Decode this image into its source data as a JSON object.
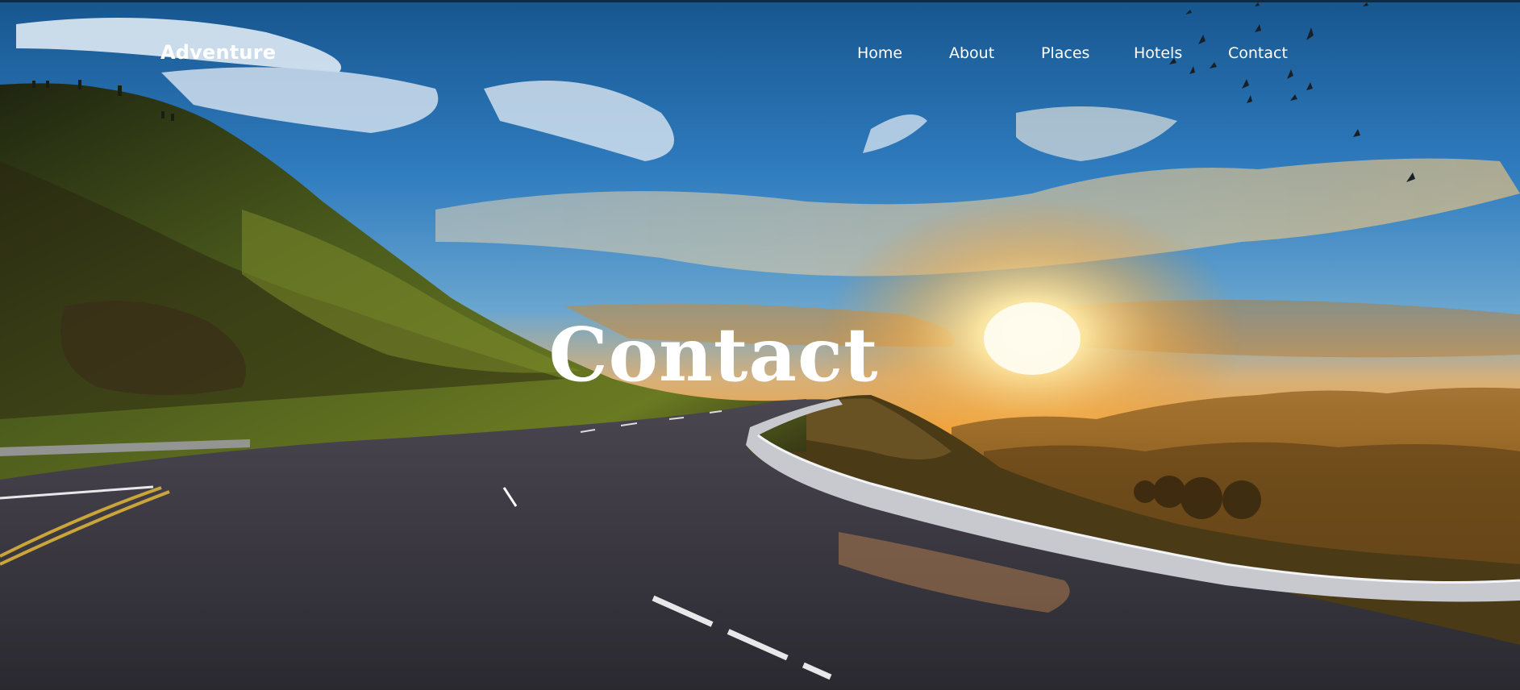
{
  "brand": {
    "name": "Adventure"
  },
  "nav": {
    "items": [
      {
        "label": "Home"
      },
      {
        "label": "About"
      },
      {
        "label": "Places"
      },
      {
        "label": "Hotels"
      },
      {
        "label": "Contact"
      }
    ]
  },
  "hero": {
    "title": "Contact"
  },
  "colors": {
    "sky_top": "#1b5d96",
    "sky_mid": "#3d8ac8",
    "sun": "#ffe9a8",
    "horizon": "#e8a23a",
    "hill": "#3a4a1c",
    "road": "#2f2e36",
    "text": "#ffffff"
  }
}
